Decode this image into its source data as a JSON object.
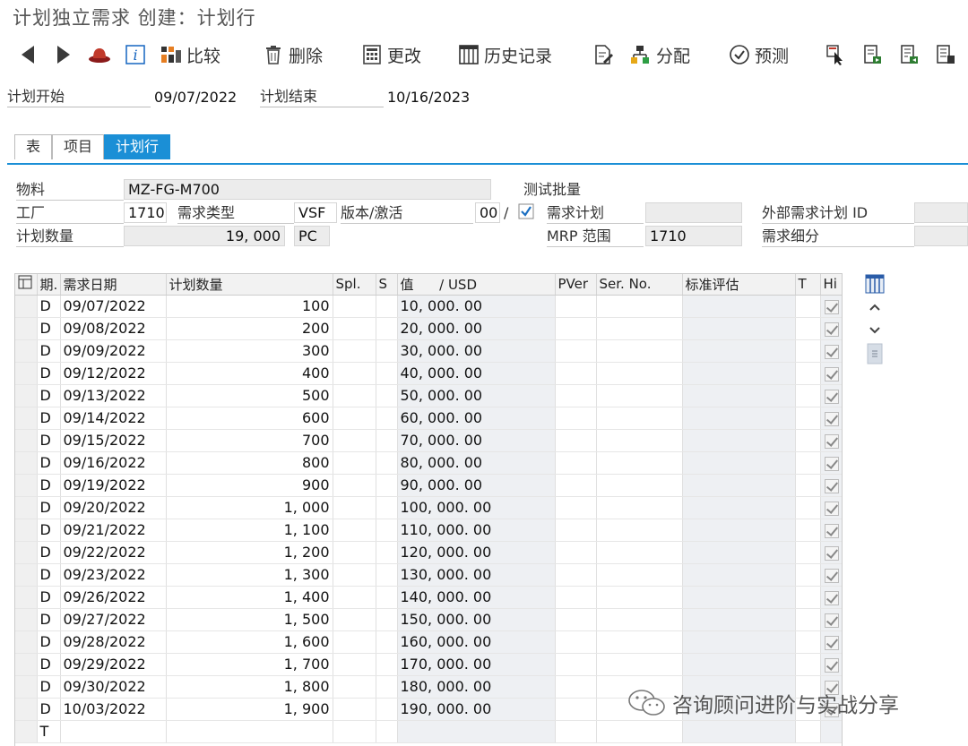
{
  "window": {
    "title": "计划独立需求 创建：计划行"
  },
  "toolbar": {
    "compare": "比较",
    "delete": "删除",
    "change": "更改",
    "history": "历史记录",
    "distribute": "分配",
    "forecast": "预测"
  },
  "header": {
    "plan_start_label": "计划开始",
    "plan_start_value": "09/07/2022",
    "plan_end_label": "计划结束",
    "plan_end_value": "10/16/2023"
  },
  "tabs": [
    "表",
    "项目",
    "计划行"
  ],
  "fields": {
    "material_label": "物料",
    "material_value": "MZ-FG-M700",
    "test_batch_label": "测试批量",
    "plant_label": "工厂",
    "plant_value": "1710",
    "req_type_label": "需求类型",
    "req_type_value": "VSF",
    "version_label": "版本/激活",
    "version_value": "00",
    "slash": "/",
    "req_plan_label": "需求计划",
    "ext_req_plan_label": "外部需求计划 ID",
    "plan_qty_label": "计划数量",
    "plan_qty_value": "19, 000",
    "unit_value": "PC",
    "mrp_area_label": "MRP 范围",
    "mrp_area_value": "1710",
    "req_segment_label": "需求细分"
  },
  "grid": {
    "columns": [
      "期.",
      "需求日期",
      "计划数量",
      "Spl.",
      "S",
      "值",
      "/ USD",
      "PVer",
      "Ser. No.",
      "标准评估",
      "T",
      "Hi"
    ],
    "rows": [
      {
        "p": "D",
        "date": "09/07/2022",
        "qty": "100",
        "val": "10, 000. 00"
      },
      {
        "p": "D",
        "date": "09/08/2022",
        "qty": "200",
        "val": "20, 000. 00"
      },
      {
        "p": "D",
        "date": "09/09/2022",
        "qty": "300",
        "val": "30, 000. 00"
      },
      {
        "p": "D",
        "date": "09/12/2022",
        "qty": "400",
        "val": "40, 000. 00"
      },
      {
        "p": "D",
        "date": "09/13/2022",
        "qty": "500",
        "val": "50, 000. 00"
      },
      {
        "p": "D",
        "date": "09/14/2022",
        "qty": "600",
        "val": "60, 000. 00"
      },
      {
        "p": "D",
        "date": "09/15/2022",
        "qty": "700",
        "val": "70, 000. 00"
      },
      {
        "p": "D",
        "date": "09/16/2022",
        "qty": "800",
        "val": "80, 000. 00"
      },
      {
        "p": "D",
        "date": "09/19/2022",
        "qty": "900",
        "val": "90, 000. 00"
      },
      {
        "p": "D",
        "date": "09/20/2022",
        "qty": "1, 000",
        "val": "100, 000. 00"
      },
      {
        "p": "D",
        "date": "09/21/2022",
        "qty": "1, 100",
        "val": "110, 000. 00"
      },
      {
        "p": "D",
        "date": "09/22/2022",
        "qty": "1, 200",
        "val": "120, 000. 00"
      },
      {
        "p": "D",
        "date": "09/23/2022",
        "qty": "1, 300",
        "val": "130, 000. 00"
      },
      {
        "p": "D",
        "date": "09/26/2022",
        "qty": "1, 400",
        "val": "140, 000. 00"
      },
      {
        "p": "D",
        "date": "09/27/2022",
        "qty": "1, 500",
        "val": "150, 000. 00"
      },
      {
        "p": "D",
        "date": "09/28/2022",
        "qty": "1, 600",
        "val": "160, 000. 00"
      },
      {
        "p": "D",
        "date": "09/29/2022",
        "qty": "1, 700",
        "val": "170, 000. 00"
      },
      {
        "p": "D",
        "date": "09/30/2022",
        "qty": "1, 800",
        "val": "180, 000. 00"
      },
      {
        "p": "D",
        "date": "10/03/2022",
        "qty": "1, 900",
        "val": "190, 000. 00"
      },
      {
        "p": "T",
        "date": "",
        "qty": "",
        "val": ""
      }
    ]
  },
  "watermark": {
    "text": "咨询顾问进阶与实战分享"
  },
  "colors": {
    "accent": "#1b8fd6",
    "nav_arrow": "#3a3a3a",
    "red_hat": "#c0392b",
    "info_blue": "#1565c0"
  },
  "icons": [
    "back-arrow-icon",
    "forward-arrow-icon",
    "hat-icon",
    "info-icon",
    "compare-icon",
    "trash-icon",
    "change-icon",
    "history-icon",
    "edit-doc-icon",
    "distribute-icon",
    "forecast-icon",
    "cursor-doc-icon",
    "doc-flag-icon",
    "doc-list-icon",
    "doc-grid-icon"
  ]
}
